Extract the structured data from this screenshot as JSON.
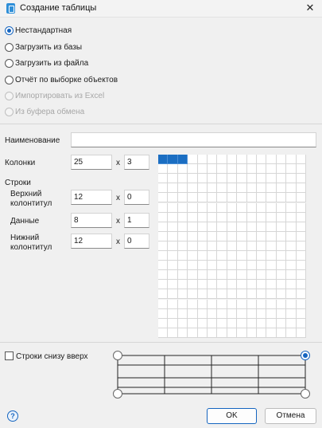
{
  "window": {
    "title": "Создание таблицы",
    "close_icon": "close-icon",
    "app_icon": "table-app-icon"
  },
  "source_options": [
    {
      "label": "Нестандартная",
      "checked": true,
      "disabled": false
    },
    {
      "label": "Загрузить из базы",
      "checked": false,
      "disabled": false
    },
    {
      "label": "Загрузить из файла",
      "checked": false,
      "disabled": false
    },
    {
      "label": "Отчёт по выборке объектов",
      "checked": false,
      "disabled": false
    },
    {
      "label": "Импортировать из Excel",
      "checked": false,
      "disabled": true
    },
    {
      "label": "Из буфера обмена",
      "checked": false,
      "disabled": true
    }
  ],
  "name": {
    "label": "Наименование",
    "value": ""
  },
  "columns": {
    "label": "Колонки",
    "width": "25",
    "count": "3"
  },
  "rows": {
    "label": "Строки",
    "header": {
      "label_line1": "Верхний",
      "label_line2": "колонтитул",
      "height": "12",
      "count": "0"
    },
    "data": {
      "label": "Данные",
      "height": "8",
      "count": "1"
    },
    "footer": {
      "label_line1": "Нижний",
      "label_line2": "колонтитул",
      "height": "12",
      "count": "0"
    }
  },
  "times_sign": "x",
  "preview_grid": {
    "columns": 15,
    "rows": 19,
    "selected_columns": 3,
    "selected_rows": 1,
    "selected_color": "#1b6ec2"
  },
  "bottom_up": {
    "label": "Строки снизу вверх",
    "checked": false
  },
  "buttons": {
    "ok": "OK",
    "cancel": "Отмена",
    "help": "?"
  },
  "colors": {
    "accent": "#1565c0",
    "background": "#f0f0f0"
  }
}
